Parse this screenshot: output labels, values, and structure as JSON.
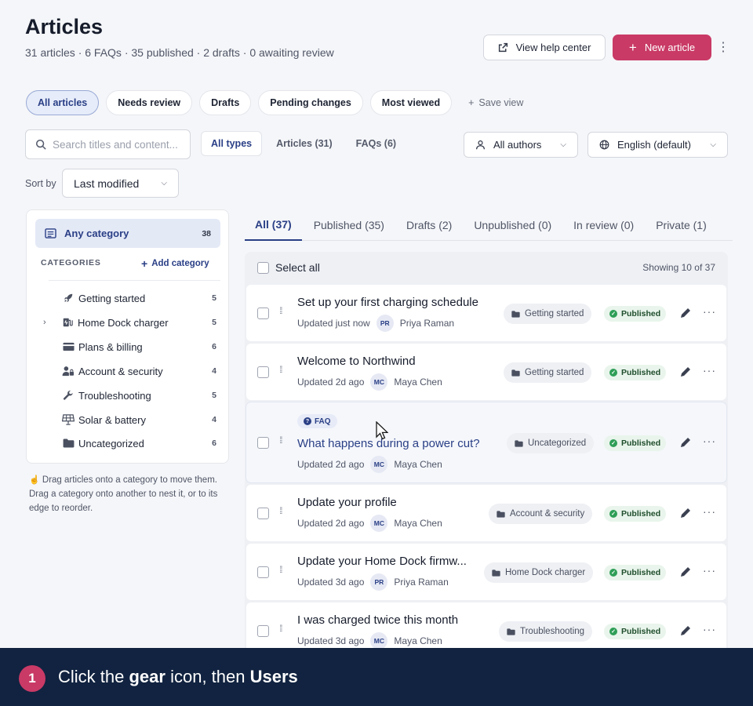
{
  "header": {
    "title": "Articles",
    "subtitle": "31 articles · 6 FAQs · 35 published · 2 drafts · 0 awaiting review",
    "help_button": "View help center",
    "new_button": "New article"
  },
  "views": {
    "items": [
      "All articles",
      "Needs review",
      "Drafts",
      "Pending changes",
      "Most viewed"
    ],
    "save_view": "Save view"
  },
  "search": {
    "placeholder": "Search titles and content..."
  },
  "type_filter": [
    "All types",
    "Articles (31)",
    "FAQs (6)"
  ],
  "authors_filter": "All authors",
  "language_filter": "English (default)",
  "sort": {
    "label": "Sort by",
    "value": "Last modified"
  },
  "categories": {
    "any_label": "Any category",
    "any_count": "38",
    "header": "CATEGORIES",
    "add_label": "Add category",
    "items": [
      {
        "label": "Getting started",
        "count": "5",
        "icon": "rocket-icon"
      },
      {
        "label": "Home Dock charger",
        "count": "5",
        "icon": "charger-icon"
      },
      {
        "label": "Plans & billing",
        "count": "6",
        "icon": "credit-card-icon"
      },
      {
        "label": "Account & security",
        "count": "4",
        "icon": "user-lock-icon"
      },
      {
        "label": "Troubleshooting",
        "count": "5",
        "icon": "wrench-icon"
      },
      {
        "label": "Solar & battery",
        "count": "4",
        "icon": "solar-panel-icon"
      },
      {
        "label": "Uncategorized",
        "count": "6",
        "icon": "folder-icon"
      }
    ],
    "drag_hint": "Drag articles onto a category to move them. Drag a category onto another to nest it, or to its edge to reorder."
  },
  "status_tabs": [
    "All (37)",
    "Published (35)",
    "Drafts (2)",
    "Unpublished (0)",
    "In review (0)",
    "Private (1)"
  ],
  "list": {
    "select_all": "Select all",
    "showing": "Showing 10 of 37",
    "rows": [
      {
        "title": "Set up your first charging schedule",
        "updated": "Updated just now",
        "initials": "PR",
        "author": "Priya Raman",
        "category": "Getting started",
        "status": "Published"
      },
      {
        "title": "Welcome to Northwind",
        "updated": "Updated 2d ago",
        "initials": "MC",
        "author": "Maya Chen",
        "category": "Getting started",
        "status": "Published"
      },
      {
        "title": "What happens during a power cut?",
        "tag": "FAQ",
        "updated": "Updated 2d ago",
        "initials": "MC",
        "author": "Maya Chen",
        "category": "Uncategorized",
        "status": "Published"
      },
      {
        "title": "Update your profile",
        "updated": "Updated 2d ago",
        "initials": "MC",
        "author": "Maya Chen",
        "category": "Account & security",
        "status": "Published"
      },
      {
        "title": "Update your Home Dock firmw...",
        "updated": "Updated 3d ago",
        "initials": "PR",
        "author": "Priya Raman",
        "category": "Home Dock charger",
        "status": "Published"
      },
      {
        "title": "I was charged twice this month",
        "updated": "Updated 3d ago",
        "initials": "MC",
        "author": "Maya Chen",
        "category": "Troubleshooting",
        "status": "Published"
      }
    ]
  },
  "banner": {
    "step": "1",
    "text_1": "Click the ",
    "bold_1": "gear",
    "text_2": " icon, then ",
    "bold_2": "Users"
  },
  "colors": {
    "accent": "#c93a66",
    "primary": "#2a3f86",
    "banner": "#112340",
    "success": "#2e9e57"
  }
}
